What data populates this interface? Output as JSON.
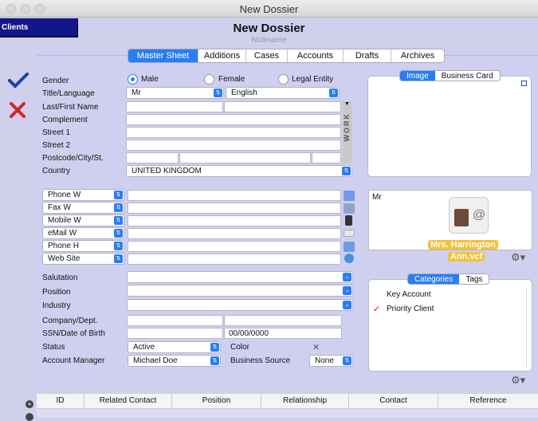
{
  "window": {
    "title": "New Dossier"
  },
  "sidebar": {
    "clients_label": "Clients"
  },
  "header": {
    "title": "New Dossier",
    "nickname_placeholder": "Nickname"
  },
  "tabs": [
    "Master Sheet",
    "Additions",
    "Cases",
    "Accounts",
    "Drafts",
    "Archives"
  ],
  "form": {
    "gender_label": "Gender",
    "gender_options": [
      "Male",
      "Female",
      "Legal Entity"
    ],
    "title_language_label": "Title/Language",
    "title_value": "Mr",
    "language_value": "English",
    "last_first_label": "Last/First Name",
    "complement_label": "Complement",
    "street1_label": "Street 1",
    "street2_label": "Street 2",
    "postcode_label": "Postcode/City/St.",
    "country_label": "Country",
    "country_value": "UNITED KINGDOM",
    "work_label": "WORK",
    "contacts": [
      "Phone W",
      "Fax W",
      "Mobile W",
      "eMail W",
      "Phone H",
      "Web Site"
    ],
    "salutation_label": "Salutation",
    "position_label": "Position",
    "industry_label": "Industry",
    "company_label": "Company/Dept.",
    "ssn_label": "SSN/Date of Birth",
    "dob_value": "00/00/0000",
    "status_label": "Status",
    "status_value": "Active",
    "color_label": "Color",
    "color_value": "✕",
    "account_manager_label": "Account Manager",
    "account_manager_value": "Michael Doe",
    "business_source_label": "Business Source",
    "business_source_value": "None"
  },
  "image_panel": {
    "tabs": [
      "Image",
      "Business Card"
    ]
  },
  "vcard": {
    "salutation": "Mr",
    "filename_line1": "Mrs. Harrington",
    "filename_line2": "Ann.vcf"
  },
  "categories_panel": {
    "tabs": [
      "Categories",
      "Tags"
    ],
    "items": [
      {
        "label": "Key Account",
        "checked": false
      },
      {
        "label": "Priority Client",
        "checked": true
      }
    ]
  },
  "table": {
    "columns": [
      "ID",
      "Related Contact",
      "Position",
      "Relationship",
      "Contact",
      "Reference"
    ]
  },
  "colors": {
    "accent": "#2a7ef0",
    "clients_bg": "#12168a",
    "panel_bg": "#cfcff0",
    "vcf_label": "#f2c23a"
  }
}
